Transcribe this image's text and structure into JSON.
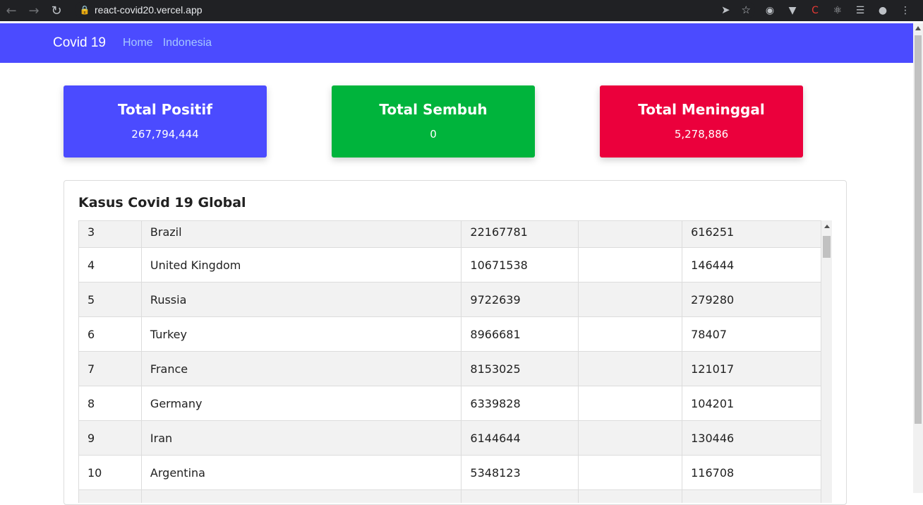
{
  "browser": {
    "url": "react-covid20.vercel.app",
    "icons": [
      "back-icon",
      "forward-icon",
      "reload-icon",
      "lock-icon",
      "send-icon",
      "star-icon",
      "extension-icon",
      "profile-icon",
      "menu-icon"
    ]
  },
  "navbar": {
    "brand": "Covid 19",
    "links": [
      "Home",
      "Indonesia"
    ]
  },
  "stats": {
    "positif": {
      "title": "Total Positif",
      "value": "267,794,444",
      "color": "#4b4bff"
    },
    "sembuh": {
      "title": "Total Sembuh",
      "value": "0",
      "color": "#00b43c"
    },
    "meninggal": {
      "title": "Total Meninggal",
      "value": "5,278,886",
      "color": "#eb003c"
    }
  },
  "table": {
    "title": "Kasus Covid 19 Global",
    "rows": [
      {
        "no": "3",
        "country": "Brazil",
        "cases": "22167781",
        "recovered": "",
        "deaths": "616251"
      },
      {
        "no": "4",
        "country": "United Kingdom",
        "cases": "10671538",
        "recovered": "",
        "deaths": "146444"
      },
      {
        "no": "5",
        "country": "Russia",
        "cases": "9722639",
        "recovered": "",
        "deaths": "279280"
      },
      {
        "no": "6",
        "country": "Turkey",
        "cases": "8966681",
        "recovered": "",
        "deaths": "78407"
      },
      {
        "no": "7",
        "country": "France",
        "cases": "8153025",
        "recovered": "",
        "deaths": "121017"
      },
      {
        "no": "8",
        "country": "Germany",
        "cases": "6339828",
        "recovered": "",
        "deaths": "104201"
      },
      {
        "no": "9",
        "country": "Iran",
        "cases": "6144644",
        "recovered": "",
        "deaths": "130446"
      },
      {
        "no": "10",
        "country": "Argentina",
        "cases": "5348123",
        "recovered": "",
        "deaths": "116708"
      },
      {
        "no": "",
        "country": "",
        "cases": "",
        "recovered": "",
        "deaths": ""
      }
    ]
  }
}
